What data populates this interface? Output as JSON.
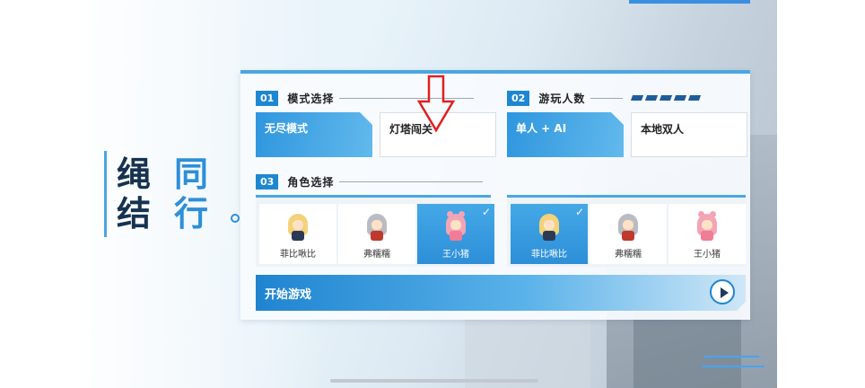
{
  "title": {
    "chars": [
      "绳",
      "结",
      "同",
      "行"
    ]
  },
  "mode_section": {
    "number": "01",
    "title": "模式选择",
    "options": [
      {
        "label": "无尽模式",
        "selected": true
      },
      {
        "label": "灯塔闯关",
        "selected": false
      }
    ]
  },
  "players_section": {
    "number": "02",
    "title": "游玩人数",
    "options": [
      {
        "label": "单人 + AI",
        "selected": true
      },
      {
        "label": "本地双人",
        "selected": false
      }
    ]
  },
  "character_section": {
    "number": "03",
    "title": "角色选择",
    "player1": [
      {
        "name": "菲比啾比",
        "selected": false
      },
      {
        "name": "弗糯糯",
        "selected": false
      },
      {
        "name": "王小猪",
        "selected": true
      }
    ],
    "player2": [
      {
        "name": "菲比啾比",
        "selected": true
      },
      {
        "name": "弗糯糯",
        "selected": false
      },
      {
        "name": "王小猪",
        "selected": false
      }
    ]
  },
  "start_button": {
    "label": "开始游戏"
  },
  "check_mark": "✓",
  "colors": {
    "accent": "#1e87d2",
    "annotation": "#e02020"
  }
}
